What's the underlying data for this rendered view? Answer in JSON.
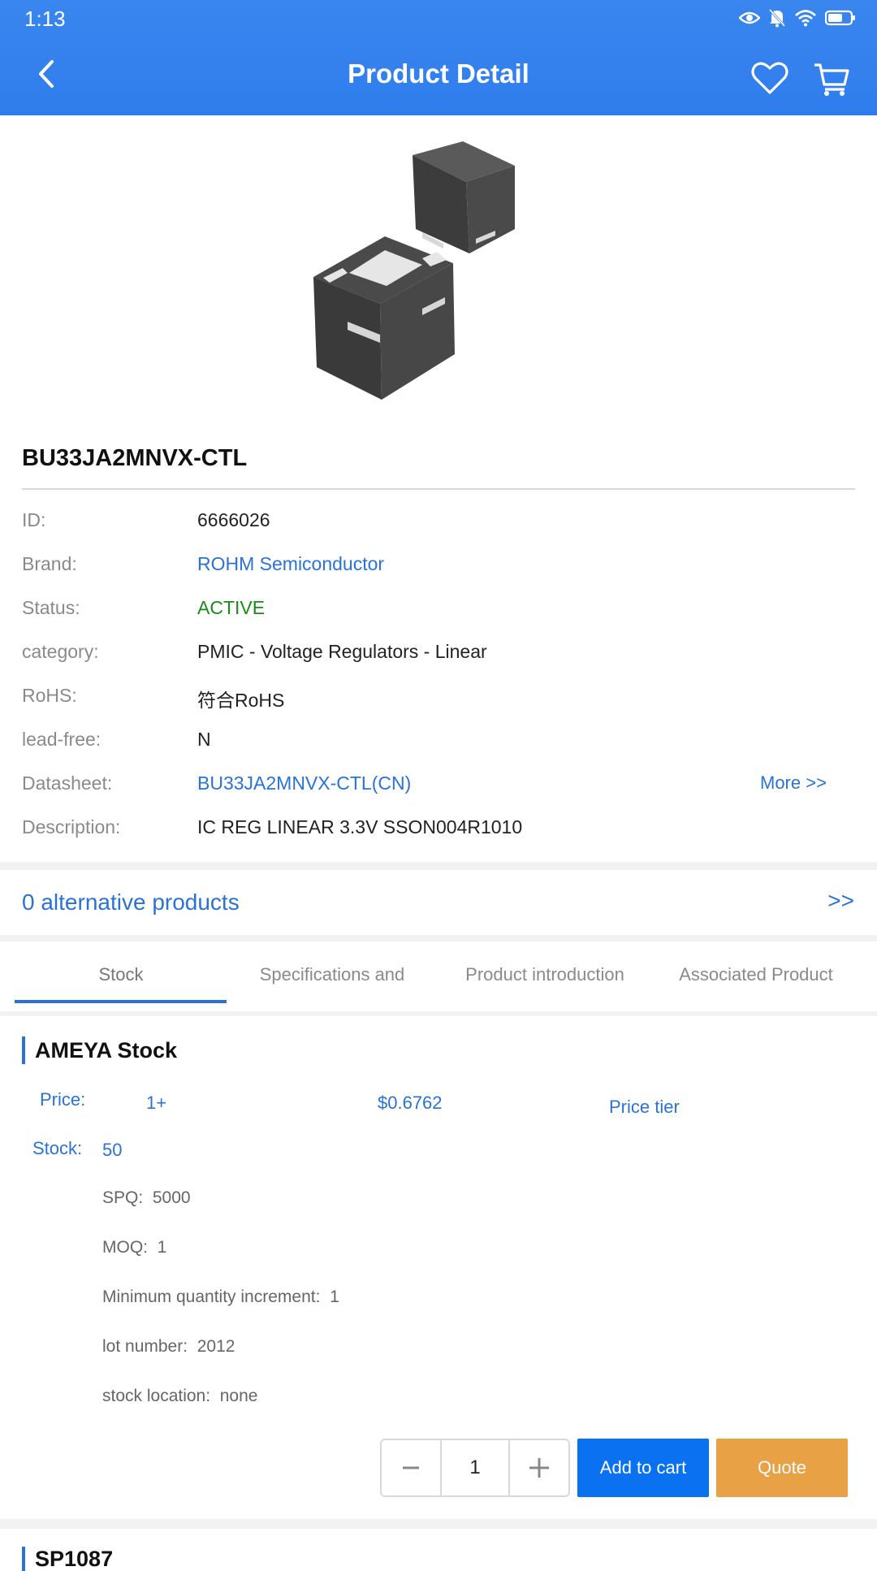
{
  "status_bar": {
    "time": "1:13",
    "icons": [
      "eye-icon",
      "bell-muted-icon",
      "wifi-icon",
      "battery-icon"
    ]
  },
  "header": {
    "title": "Product Detail"
  },
  "product": {
    "part_number": "BU33JA2MNVX-CTL",
    "fields": [
      {
        "label": "ID:",
        "value": "6666026",
        "style": "normal"
      },
      {
        "label": "Brand:",
        "value": "ROHM Semiconductor",
        "style": "link"
      },
      {
        "label": "Status:",
        "value": "ACTIVE",
        "style": "green"
      },
      {
        "label": "category:",
        "value": "PMIC - Voltage Regulators - Linear",
        "style": "normal"
      },
      {
        "label": "RoHS:",
        "value": "符合RoHS",
        "style": "normal"
      },
      {
        "label": "lead-free:",
        "value": "N",
        "style": "normal"
      },
      {
        "label": "Datasheet:",
        "value": "BU33JA2MNVX-CTL(CN)",
        "style": "link"
      },
      {
        "label": "Description:",
        "value": "IC REG LINEAR 3.3V SSON004R1010",
        "style": "normal"
      }
    ],
    "more_link": "More >>"
  },
  "alternatives": {
    "label": "0 alternative products",
    "arrow": ">>"
  },
  "tabs": [
    {
      "label": "Stock",
      "active": true
    },
    {
      "label": "Specifications and",
      "active": false
    },
    {
      "label": "Product introduction",
      "active": false
    },
    {
      "label": "Associated Product",
      "active": false
    }
  ],
  "stock": {
    "heading": "AMEYA Stock",
    "price_label": "Price:",
    "price_qty": "1+",
    "price_value": "$0.6762",
    "price_tier_link": "Price tier",
    "stock_label": "Stock:",
    "stock_value": "50",
    "details": [
      {
        "label": "SPQ:",
        "value": "5000"
      },
      {
        "label": "MOQ:",
        "value": "1"
      },
      {
        "label": "Minimum quantity increment:",
        "value": "1"
      },
      {
        "label": "lot number:",
        "value": "2012"
      },
      {
        "label": "stock location:",
        "value": "none"
      }
    ],
    "quantity": "1",
    "add_to_cart": "Add to cart",
    "quote": "Quote"
  },
  "next_section": {
    "heading": "SP1087"
  },
  "colors": {
    "primary": "#2f7ded",
    "link": "#2a73d6",
    "active_status": "#1b8a1b",
    "add_cart": "#0a72f0",
    "quote": "#e9a145"
  }
}
